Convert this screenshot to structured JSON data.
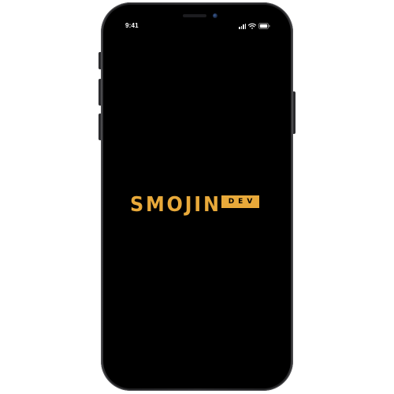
{
  "status_bar": {
    "time": "9:41",
    "icons": [
      "signal-icon",
      "wifi-icon",
      "battery-icon"
    ]
  },
  "splash": {
    "logo_wordmark": "SMOJIN",
    "logo_badge": "DEV",
    "brand_color": "#e8a93a",
    "background_color": "#000000"
  },
  "device": {
    "frame_color": "#2b2b2e"
  }
}
